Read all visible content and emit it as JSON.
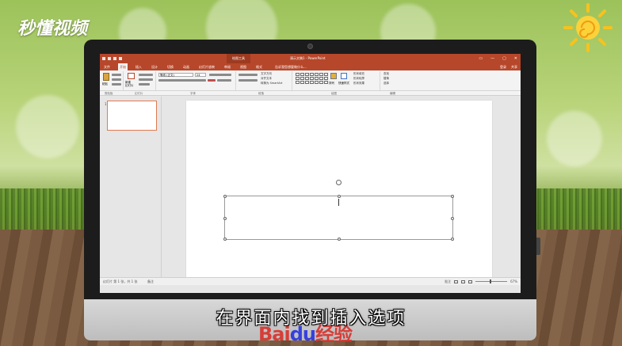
{
  "logo": {
    "text": "秒懂视频"
  },
  "powerpoint": {
    "context_tab_label": "绘图工具",
    "doc_title": "演示文稿1 - PowerPoint",
    "tabs": [
      "文件",
      "开始",
      "插入",
      "设计",
      "切换",
      "动画",
      "幻灯片放映",
      "审阅",
      "视图",
      "格式"
    ],
    "active_tab_index": 1,
    "tellme": "告诉我您想要做什么...",
    "account": [
      "登录",
      "共享"
    ],
    "window_controls": [
      "▭",
      "—",
      "▢",
      "✕"
    ],
    "ribbon_groups": [
      "剪贴板",
      "幻灯片",
      "字体",
      "段落",
      "绘图",
      "编辑"
    ],
    "ribbon_labels": {
      "paste": "粘贴",
      "new_slide": "新建\n幻灯片",
      "font_name": "等线 (正文)",
      "font_size": "24",
      "text_direction": "文字方向",
      "align_text": "对齐文本",
      "smartart": "转换为 SmartArt",
      "arrange": "排列",
      "quick_styles": "快速样式",
      "shape_fill": "形状填充",
      "shape_outline": "形状轮廓",
      "shape_effects": "形状效果",
      "find": "查找",
      "replace": "替换",
      "select": "选择"
    },
    "thumbnail_number": "1",
    "status": {
      "slide_info": "幻灯片 第 1 张，共 1 张",
      "notes": "备注",
      "comments": "批注",
      "zoom": "67%"
    }
  },
  "subtitle": "在界面内找到插入选项",
  "watermark": {
    "part1": "Bai",
    "part2": "du",
    "part3": "经验"
  }
}
